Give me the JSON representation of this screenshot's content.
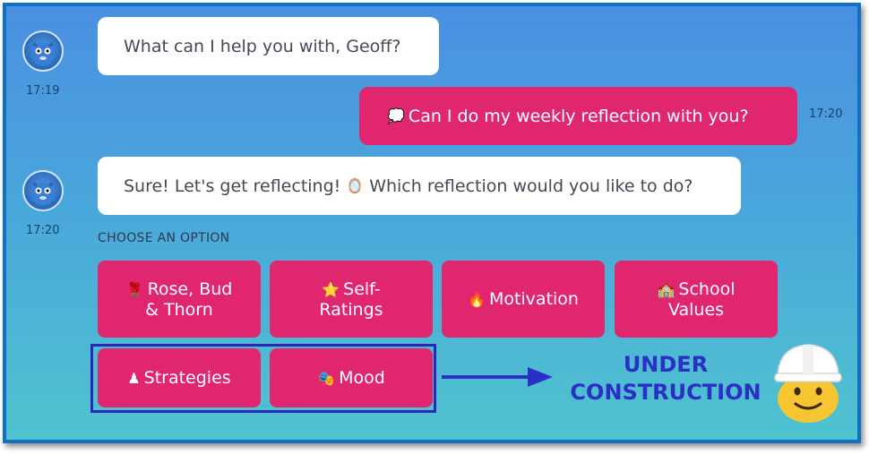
{
  "messages": [
    {
      "sender": "bot",
      "text": "What can I help you with, Geoff?",
      "time": "17:19"
    },
    {
      "sender": "user",
      "icon": "speech-bubble-icon",
      "glyph": "💭",
      "text": "Can I do my weekly reflection with you?",
      "time": "17:20"
    },
    {
      "sender": "bot",
      "text_before": "Sure! Let's get reflecting!",
      "glyph": "🪞",
      "text_after": "Which reflection would you like to do?",
      "time": "17:20"
    }
  ],
  "choose_label": "CHOOSE AN OPTION",
  "options_row1": [
    {
      "glyph": "🌹",
      "line1": "Rose, Bud",
      "line2": "& Thorn"
    },
    {
      "glyph": "⭐",
      "line1": "Self-",
      "line2": "Ratings"
    },
    {
      "glyph": "🔥",
      "line1": "Motivation",
      "line2": ""
    },
    {
      "glyph": "🏫",
      "line1": "School",
      "line2": "Values"
    }
  ],
  "options_row2": [
    {
      "glyph": "♟",
      "line1": "Strategies"
    },
    {
      "glyph": "🎭",
      "line1": "Mood"
    }
  ],
  "annotation": {
    "line1": "UNDER",
    "line2": "CONSTRUCTION"
  },
  "colors": {
    "accent": "#e0266f",
    "frame": "#1270c4",
    "annotation": "#2b2fc4"
  }
}
